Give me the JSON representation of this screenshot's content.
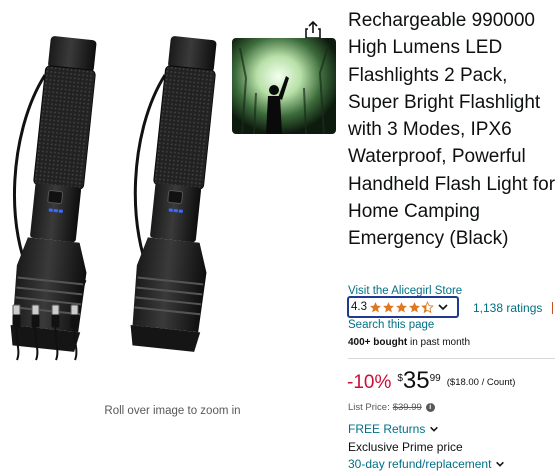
{
  "product": {
    "title": "Rechargeable 990000 High Lumens LED Flashlights 2 Pack, Super Bright Flashlight with 3 Modes, IPX6 Waterproof, Powerful Handheld Flash Light for Home Camping Emergency (Black)",
    "store_link": "Visit the Alicegirl Store",
    "rating_value": "4.3",
    "rating_stars": 4.3,
    "ratings_count": "1,138 ratings",
    "search_link": "Search this page",
    "bought_bold": "400+ bought",
    "bought_rest": " in past month"
  },
  "price": {
    "discount": "-10%",
    "currency": "$",
    "whole": "35",
    "fraction": "99",
    "unit_price": "($18.00 / Count)",
    "list_label": "List Price:",
    "list_value": "$39.99"
  },
  "shipping": {
    "free_returns": "FREE Returns",
    "prime_price": "Exclusive Prime price",
    "refund": "30-day refund/replacement"
  },
  "gallery": {
    "zoom_hint": "Roll over image to zoom in"
  },
  "colors": {
    "link": "#007185",
    "discount": "#cc0c39",
    "star": "#de7921",
    "rating_focus": "#1f3a93"
  }
}
